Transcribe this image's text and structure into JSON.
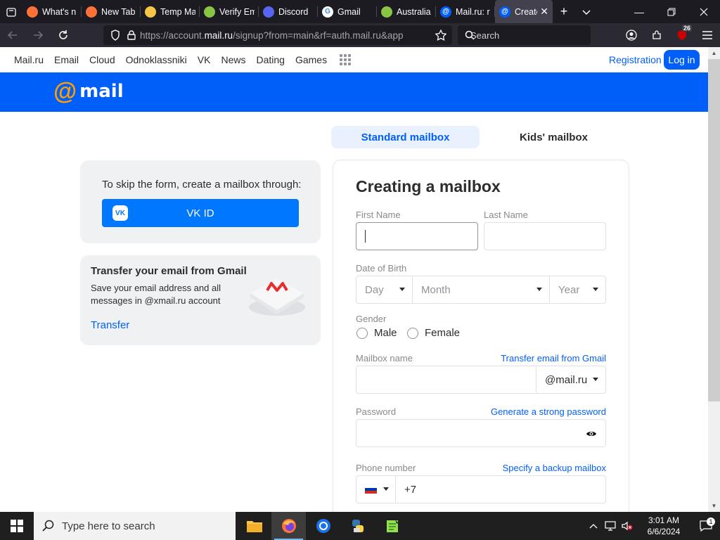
{
  "browser": {
    "tabs": [
      {
        "title": "What's n",
        "icon": "firefox-icon",
        "color": "#ff7139"
      },
      {
        "title": "New Tab",
        "icon": "firefox-icon",
        "color": "#ff7139"
      },
      {
        "title": "Temp Ma",
        "icon": "temp-mail-icon",
        "color": "#f7c548"
      },
      {
        "title": "Verify Em",
        "icon": "verify-icon",
        "color": "#88c542"
      },
      {
        "title": "Discord",
        "icon": "discord-icon",
        "color": "#5865f2"
      },
      {
        "title": "Gmail",
        "icon": "google-icon",
        "color": "#ffffff"
      },
      {
        "title": "Australia",
        "icon": "australia-icon",
        "color": "#88c542"
      },
      {
        "title": "Mail.ru: r",
        "icon": "mailru-icon",
        "color": "#005ff9"
      },
      {
        "title": "Create",
        "icon": "mailru-icon",
        "color": "#005ff9",
        "active": true
      }
    ],
    "url_prefix": "https://account.",
    "url_host": "mail.ru",
    "url_rest": "/signup?from=main&rf=auth.mail.ru&app",
    "search_placeholder": "Search",
    "extension_badge": "26"
  },
  "portal": {
    "links": [
      "Mail.ru",
      "Email",
      "Cloud",
      "Odnoklassniki",
      "VK",
      "News",
      "Dating",
      "Games"
    ],
    "registration": "Registration",
    "login": "Log in"
  },
  "brand": {
    "at": "@",
    "word": "mail"
  },
  "mailbox_tabs": {
    "standard": "Standard mailbox",
    "kids": "Kids' mailbox"
  },
  "skip": {
    "text": "To skip the form, create a mailbox through:",
    "vk_button": "VK ID"
  },
  "gmail_card": {
    "title": "Transfer your email from Gmail",
    "desc": "Save your email address and all messages in @xmail.ru account",
    "link": "Transfer"
  },
  "form": {
    "title": "Creating a mailbox",
    "first_name_label": "First Name",
    "last_name_label": "Last Name",
    "dob_label": "Date of Birth",
    "day": "Day",
    "month": "Month",
    "year": "Year",
    "gender_label": "Gender",
    "male": "Male",
    "female": "Female",
    "mailbox_label": "Mailbox name",
    "transfer_link": "Transfer email from Gmail",
    "domain": "@mail.ru",
    "password_label": "Password",
    "generate_link": "Generate a strong password",
    "phone_label": "Phone number",
    "backup_link": "Specify a backup mailbox",
    "phone_prefix": "+7"
  },
  "taskbar": {
    "search_placeholder": "Type here to search",
    "time": "3:01 AM",
    "date": "6/6/2024",
    "notif_count": "1"
  },
  "colors": {
    "accent": "#005ff9",
    "brand_orange": "#ff9e00",
    "vk": "#0077ff"
  }
}
